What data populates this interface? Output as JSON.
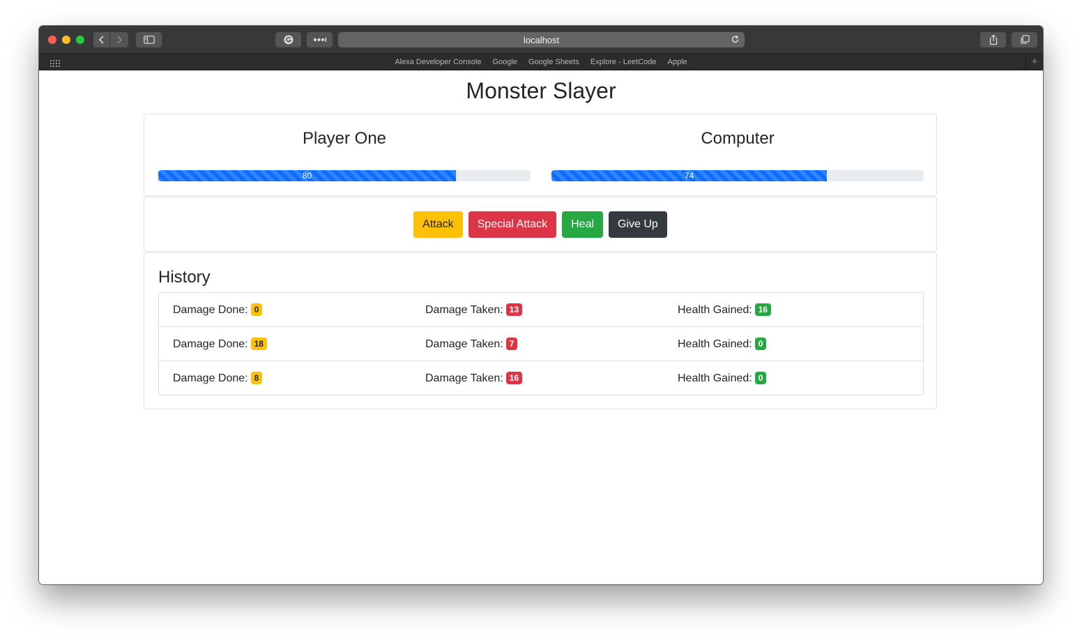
{
  "browser": {
    "address": "localhost",
    "favorites": [
      "Alexa Developer Console",
      "Google",
      "Google Sheets",
      "Explore - LeetCode",
      "Apple"
    ],
    "new_tab_glyph": "+"
  },
  "page": {
    "title": "Monster Slayer"
  },
  "players": [
    {
      "name": "Player One",
      "health": 80
    },
    {
      "name": "Computer",
      "health": 74
    }
  ],
  "controls": {
    "attack": "Attack",
    "special_attack": "Special Attack",
    "heal": "Heal",
    "give_up": "Give Up"
  },
  "history": {
    "title": "History",
    "labels": {
      "damage_done": "Damage Done:",
      "damage_taken": "Damage Taken:",
      "health_gained": "Health Gained:"
    },
    "entries": [
      {
        "damage_done": "0",
        "damage_taken": "13",
        "health_gained": "16"
      },
      {
        "damage_done": "18",
        "damage_taken": "7",
        "health_gained": "0"
      },
      {
        "damage_done": "8",
        "damage_taken": "16",
        "health_gained": "0"
      }
    ]
  },
  "colors": {
    "progress": "#0d6efd",
    "warning": "#ffc107",
    "danger": "#dc3545",
    "success": "#28a745",
    "dark": "#343a40"
  }
}
